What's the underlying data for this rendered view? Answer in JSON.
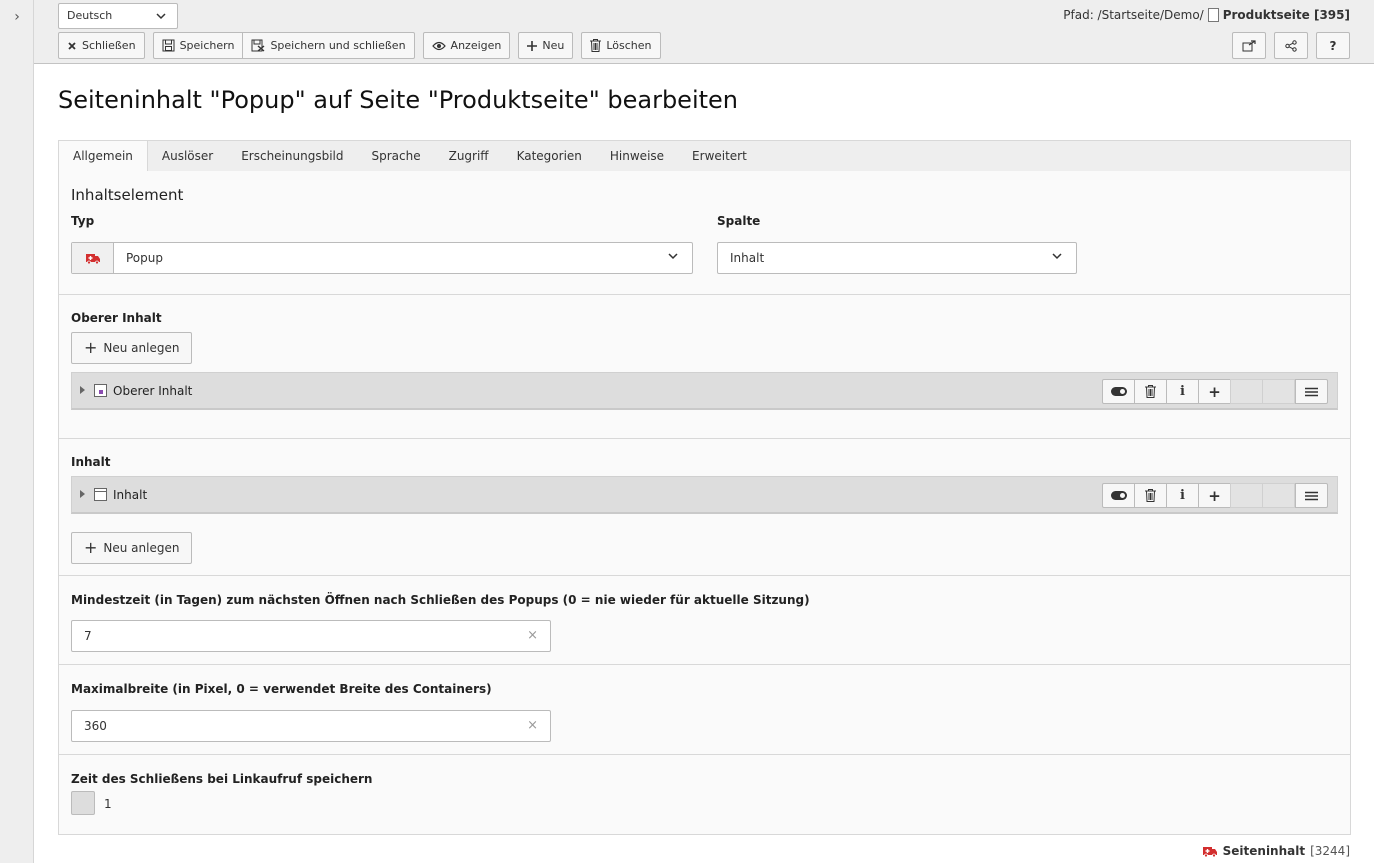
{
  "rail": {
    "toggle_glyph": "›"
  },
  "header": {
    "language": "Deutsch",
    "path_label": "Pfad: /Startseite/Demo/",
    "path_page": "Produktseite [395]",
    "buttons": {
      "close": "Schließen",
      "save": "Speichern",
      "save_close": "Speichern und schließen",
      "view": "Anzeigen",
      "new": "Neu",
      "delete": "Löschen"
    },
    "right_icons": [
      "external-link-icon",
      "share-icon",
      "help-icon"
    ],
    "help_glyph": "?"
  },
  "page": {
    "title": "Seiteninhalt \"Popup\" auf Seite \"Produktseite\" bearbeiten"
  },
  "tabs": [
    "Allgemein",
    "Auslöser",
    "Erscheinungsbild",
    "Sprache",
    "Zugriff",
    "Kategorien",
    "Hinweise",
    "Erweitert"
  ],
  "form": {
    "legend": "Inhaltselement",
    "type_label": "Typ",
    "type_value": "Popup",
    "column_label": "Spalte",
    "column_value": "Inhalt",
    "upper_content": {
      "label": "Oberer Inhalt",
      "add_button": "Neu anlegen",
      "record_title": "Oberer Inhalt"
    },
    "content": {
      "label": "Inhalt",
      "record_title": "Inhalt",
      "add_button": "Neu anlegen"
    },
    "min_time": {
      "label": "Mindestzeit (in Tagen) zum nächsten Öffnen nach Schließen des Popups (0 = nie wieder für aktuelle Sitzung)",
      "value": "7"
    },
    "max_width": {
      "label": "Maximalbreite (in Pixel, 0 = verwendet Breite des Containers)",
      "value": "360"
    },
    "save_close_time": {
      "label": "Zeit des Schließens bei Linkaufruf speichern",
      "checkbox_label": "1"
    },
    "record_controls": {
      "info_glyph": "i",
      "add_glyph": "+"
    }
  },
  "footer": {
    "record_type": "Seiteninhalt",
    "record_id": "[3244]"
  },
  "colors": {
    "accent_red": "#d32f2f",
    "purple": "#8a4cb0",
    "chrome": "#eeeeee"
  }
}
